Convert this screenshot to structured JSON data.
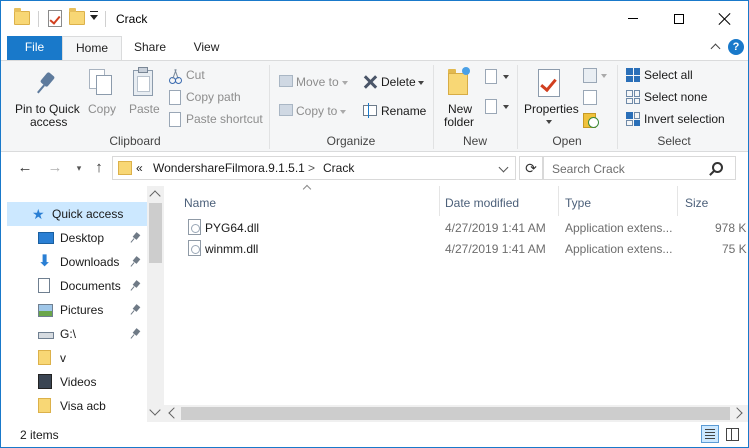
{
  "window": {
    "title": "Crack",
    "controls": {
      "minimize": "minimize-icon",
      "maximize": "maximize-icon",
      "close": "close-icon"
    }
  },
  "ribbon_tabs": [
    "File",
    "Home",
    "Share",
    "View"
  ],
  "ribbon": {
    "clipboard": {
      "label": "Clipboard",
      "pin_to_quick_access_line1": "Pin to Quick",
      "pin_to_quick_access_line2": "access",
      "copy": "Copy",
      "paste": "Paste",
      "cut": "Cut",
      "copy_path": "Copy path",
      "paste_shortcut": "Paste shortcut"
    },
    "organize": {
      "label": "Organize",
      "move_to": "Move to",
      "copy_to": "Copy to",
      "delete": "Delete",
      "rename": "Rename"
    },
    "new": {
      "label": "New",
      "new_folder_line1": "New",
      "new_folder_line2": "folder"
    },
    "open": {
      "label": "Open",
      "properties": "Properties"
    },
    "select": {
      "label": "Select",
      "select_all": "Select all",
      "select_none": "Select none",
      "invert_selection": "Invert selection"
    }
  },
  "address": {
    "overflow": "«",
    "crumbs": [
      "WondershareFilmora.9.1.5.1",
      "Crack"
    ],
    "separator": ">"
  },
  "search": {
    "placeholder": "Search Crack"
  },
  "nav_pane": {
    "items": [
      {
        "label": "Quick access",
        "icon": "star-icon",
        "pinned": false,
        "selected": true
      },
      {
        "label": "Desktop",
        "icon": "desktop-icon",
        "pinned": true
      },
      {
        "label": "Downloads",
        "icon": "download-arrow-icon",
        "pinned": true
      },
      {
        "label": "Documents",
        "icon": "documents-icon",
        "pinned": true
      },
      {
        "label": "Pictures",
        "icon": "pictures-icon",
        "pinned": true
      },
      {
        "label": "G:\\",
        "icon": "drive-icon",
        "pinned": true
      },
      {
        "label": "v",
        "icon": "folder-icon",
        "pinned": false
      },
      {
        "label": "Videos",
        "icon": "videos-icon",
        "pinned": false
      },
      {
        "label": "Visa acb",
        "icon": "folder-icon",
        "pinned": false
      }
    ]
  },
  "file_list": {
    "columns": [
      "Name",
      "Date modified",
      "Type",
      "Size"
    ],
    "rows": [
      {
        "name": "PYG64.dll",
        "date": "4/27/2019 1:41 AM",
        "type": "Application extens...",
        "size": "978 K"
      },
      {
        "name": "winmm.dll",
        "date": "4/27/2019 1:41 AM",
        "type": "Application extens...",
        "size": "75 K"
      }
    ]
  },
  "status": {
    "item_count": "2 items"
  },
  "colors": {
    "accent": "#1979ca",
    "selection": "#cce8ff",
    "ribbon_bg": "#f5f6f7"
  }
}
